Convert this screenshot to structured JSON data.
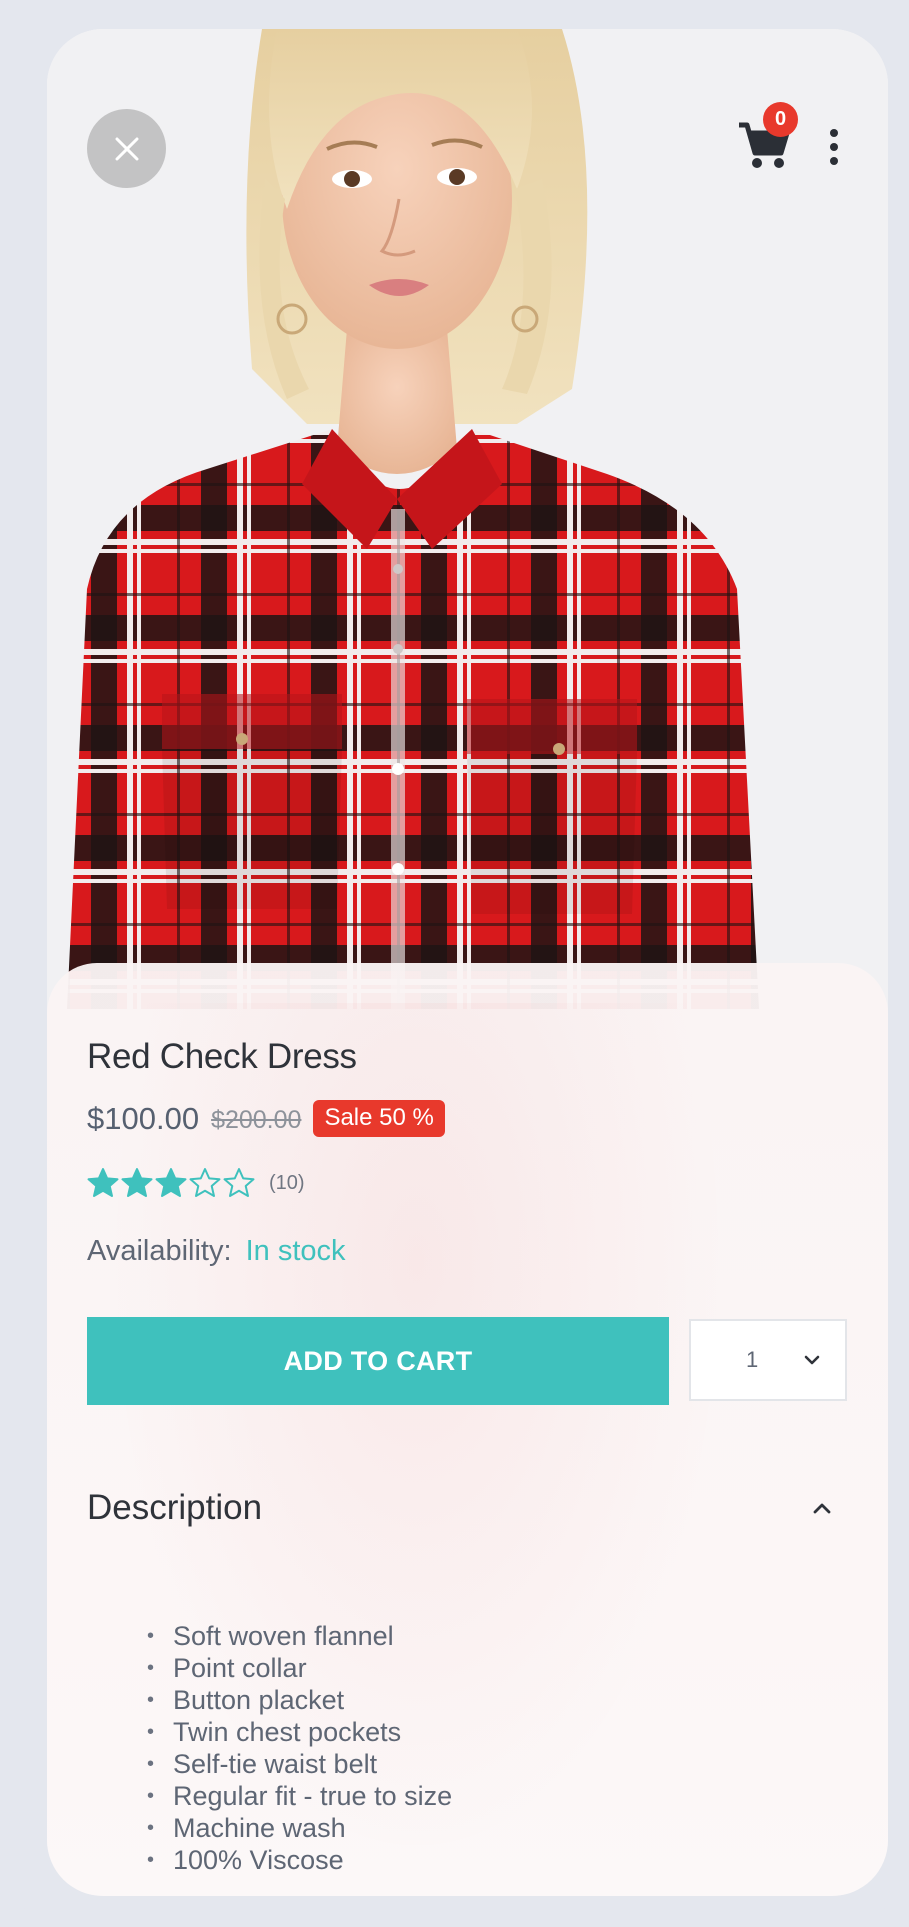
{
  "header": {
    "close_icon": "close-icon",
    "cart_icon": "cart-icon",
    "cart_count": "0",
    "more_icon": "more-vertical-icon"
  },
  "product": {
    "title": "Red Check Dress",
    "price": "$100.00",
    "old_price": "$200.00",
    "sale_label": "Sale 50 %",
    "rating": 3,
    "rating_max": 5,
    "rating_count": "(10)",
    "availability_label": "Availability:",
    "availability_status": "In stock"
  },
  "actions": {
    "add_to_cart": "ADD TO CART",
    "quantity": "1"
  },
  "description": {
    "title": "Description",
    "items": [
      "Soft woven flannel",
      "Point collar",
      "Button placket",
      "Twin chest pockets",
      "Self-tie waist belt",
      "Regular fit - true to size",
      "Machine wash",
      "100% Viscose"
    ]
  },
  "colors": {
    "accent": "#3fc1bd",
    "sale": "#e8392c",
    "text_dark": "#2f333a",
    "text_muted": "#5e6674"
  }
}
